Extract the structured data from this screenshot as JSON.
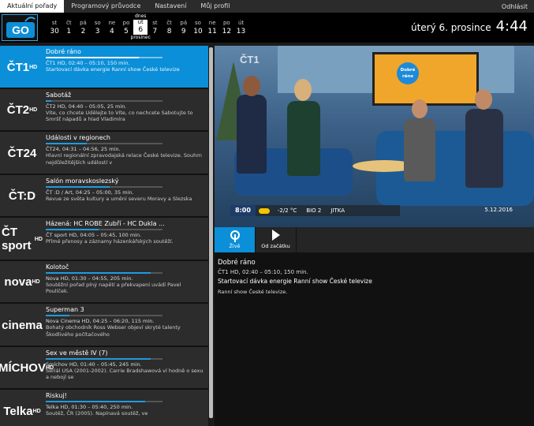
{
  "nav": {
    "tabs": [
      "Aktuální pořady",
      "Programový průvodce",
      "Nastavení",
      "Můj profil"
    ],
    "logout": "Odhlásit"
  },
  "logo": {
    "text": "GO"
  },
  "calendar": {
    "today_label": "dnes",
    "month_label": "prosinec",
    "days": [
      {
        "dn": "st",
        "dd": "30"
      },
      {
        "dn": "čt",
        "dd": "1"
      },
      {
        "dn": "pá",
        "dd": "2"
      },
      {
        "dn": "so",
        "dd": "3"
      },
      {
        "dn": "ne",
        "dd": "4"
      },
      {
        "dn": "po",
        "dd": "5"
      },
      {
        "dn": "út",
        "dd": "6"
      },
      {
        "dn": "st",
        "dd": "7"
      },
      {
        "dn": "čt",
        "dd": "8"
      },
      {
        "dn": "pá",
        "dd": "9"
      },
      {
        "dn": "so",
        "dd": "10"
      },
      {
        "dn": "ne",
        "dd": "11"
      },
      {
        "dn": "po",
        "dd": "12"
      },
      {
        "dn": "út",
        "dd": "13"
      }
    ]
  },
  "header": {
    "date": "úterý 6. prosince",
    "time": "4:44"
  },
  "channels": [
    {
      "logo": "ČT1",
      "logo_sup": "HD",
      "title": "Dobré ráno",
      "progress": 0.8,
      "time": "ČT1 HD, 02:40 – 05:10, 150 min.",
      "desc": "Startovací dávka energie Ranní show České televize"
    },
    {
      "logo": "ČT2",
      "logo_sup": "HD",
      "title": "Sabotáž",
      "progress": 0.05,
      "time": "ČT2 HD, 04:40 – 05:05, 25 min.",
      "desc": "Víte, co chcete Udělejte to Víte, co nechcete Sabotujte to Smršť nápadů a hlad Vladimíra"
    },
    {
      "logo": "ČT24",
      "logo_sup": "",
      "title": "Události v regionech",
      "progress": 0.35,
      "time": "ČT24, 04:31 – 04:56, 25 min.",
      "desc": "Hlavní regionální zpravodajská relace České televize. Souhrn nejdůležitějších událostí v"
    },
    {
      "logo": "ČT:D",
      "logo_sup": "",
      "title": "Salón moravskoslezský",
      "progress": 0.55,
      "time": "ČT :D / Art, 04:25 – 05:00, 35 min.",
      "desc": "Revue ze světa kultury a umění severu Moravy a Slezska"
    },
    {
      "logo": "ČT sport",
      "logo_sup": "HD",
      "title": "Házená: HC ROBE Zubří - HC Dukla ...",
      "progress": 0.45,
      "time": "ČT sport HD, 04:05 – 05:45, 100 min.",
      "desc": "Přímé přenosy a záznamy házenkářských soutěží."
    },
    {
      "logo": "nova",
      "logo_sup": "HD",
      "title": "Kolotoč",
      "progress": 0.9,
      "time": "Nova HD, 01:30 – 04:55, 205 min.",
      "desc": "Soutěžní pořad plný napětí a překvapení uvádí Pavel Poulíček."
    },
    {
      "logo": "cinema",
      "logo_sup": "",
      "title": "Superman 3",
      "progress": 0.2,
      "time": "Nova Cinema HD, 04:25 – 06:20, 115 min.",
      "desc": "Bohatý obchodník Ross Webser objeví skryté talenty Škodlivého počítačového"
    },
    {
      "logo": "SMÍCHOV",
      "logo_sup": "HD",
      "title": "Sex ve městě IV (7)",
      "progress": 0.9,
      "time": "Smíchov HD, 01:40 – 05:45, 245 min.",
      "desc": "Seriál USA (2001-2002). Carrie Bradshawová ví hodně o sexu a nebojí se"
    },
    {
      "logo": "Telka",
      "logo_sup": "HD",
      "title": "Riskuj!",
      "progress": 0.85,
      "time": "Telka HD, 01:30 – 05:40, 250 min.",
      "desc": "Soutěž, ČR (2005). Napínavá soutěž, ve"
    }
  ],
  "video": {
    "channel_logo": "ČT1",
    "clock": "8:00",
    "temp": "-2/2 °C",
    "ticker_item1": "BIO 2",
    "ticker_item2": "JITKA",
    "date": "5.12.2016",
    "badge_line1": "Dobré",
    "badge_line2": "ráno"
  },
  "controls": {
    "live": "Živě",
    "from_start": "Od začátku"
  },
  "detail": {
    "title": "Dobré ráno",
    "time": "ČT1 HD, 02:40 – 05:10, 150 min.",
    "subtitle": "Startovací dávka energie Ranní show České televize",
    "desc": "Ranní show České televize."
  },
  "colors": {
    "accent": "#0b8fd8",
    "sidebar_bg": "#2c2c2c",
    "header_bg": "#000000"
  }
}
